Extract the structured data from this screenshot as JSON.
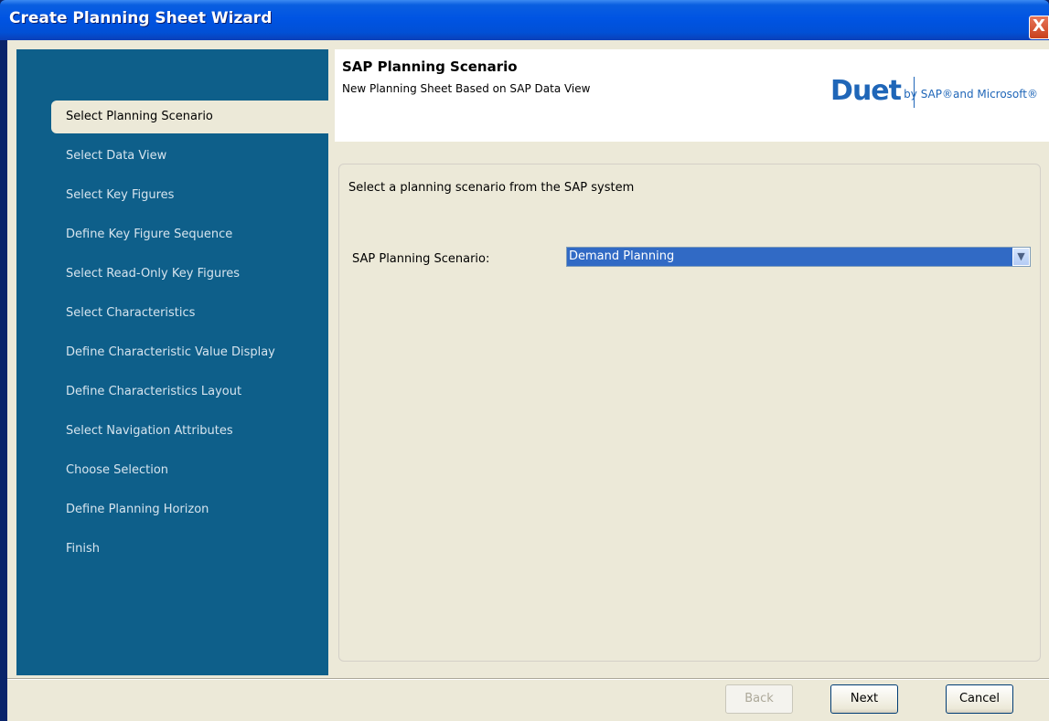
{
  "window": {
    "title": "Create Planning Sheet Wizard",
    "close_label": "X"
  },
  "sidebar": {
    "items": [
      {
        "label": "Select Planning Scenario",
        "active": true
      },
      {
        "label": "Select Data View"
      },
      {
        "label": "Select Key Figures"
      },
      {
        "label": "Define Key Figure Sequence"
      },
      {
        "label": "Select Read-Only Key Figures"
      },
      {
        "label": "Select Characteristics"
      },
      {
        "label": "Define Characteristic Value Display"
      },
      {
        "label": "Define Characteristics Layout"
      },
      {
        "label": "Select Navigation Attributes"
      },
      {
        "label": "Choose Selection"
      },
      {
        "label": "Define Planning Horizon"
      },
      {
        "label": "Finish"
      }
    ]
  },
  "header": {
    "title": "SAP Planning Scenario",
    "subtitle": "New Planning Sheet Based on SAP Data View",
    "logo_main": "Duet",
    "logo_tag": "by SAP®and Microsoft®"
  },
  "panel": {
    "instruction": "Select a planning scenario from the SAP system",
    "field_label": "SAP Planning Scenario:",
    "field_value": "Demand Planning"
  },
  "buttons": {
    "back": "Back",
    "next": "Next",
    "cancel": "Cancel"
  },
  "colors": {
    "sidebar": "#0e5f8a",
    "accent": "#316ac5",
    "logo": "#1f66b8"
  }
}
